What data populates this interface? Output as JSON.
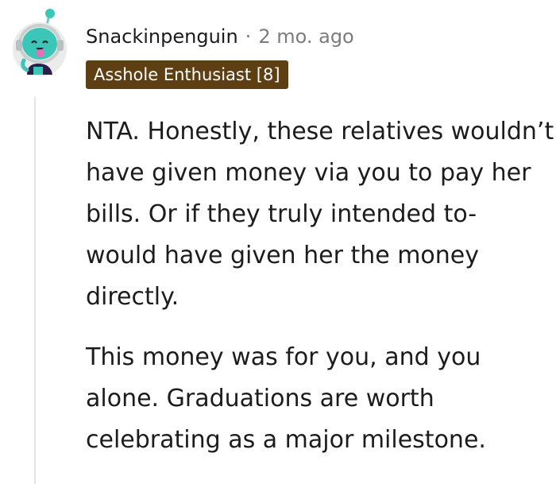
{
  "comment": {
    "username": "Snackinpenguin",
    "separator": "·",
    "timestamp": "2 mo. ago",
    "flair": "Asshole Enthusiast [8]",
    "flair_color": "#5e3f14",
    "avatar_icon": "snoo-avatar-icon",
    "paragraphs": [
      "NTA. Honestly, these relatives wouldn’t have given money via you to pay her bills. Or if they truly intended to- would have given her the money directly.",
      "This money was for you, and you alone. Graduations are worth celebrating as a major milestone."
    ]
  }
}
